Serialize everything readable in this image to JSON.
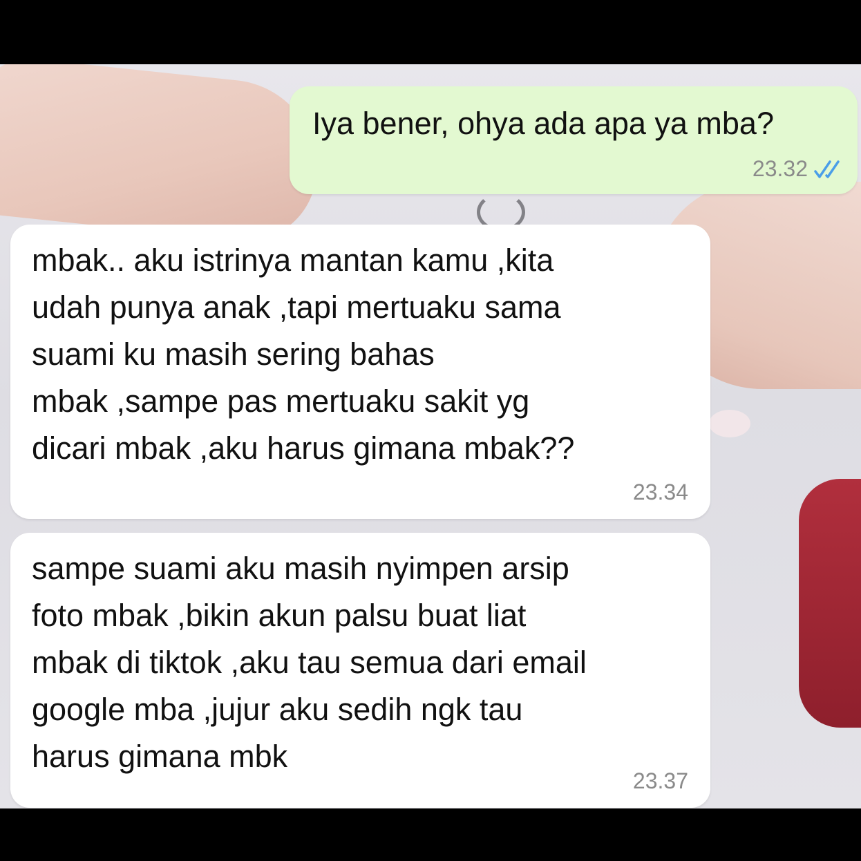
{
  "theme": {
    "outgoing_bubble_color": "#e3f9d1",
    "incoming_bubble_color": "#ffffff",
    "tick_color": "#4a9ee8"
  },
  "messages": [
    {
      "direction": "outgoing",
      "text": "Iya bener, ohya ada apa ya mba?",
      "time": "23.32",
      "status_icon": "double-check-read-icon"
    },
    {
      "direction": "incoming",
      "text": "mbak.. aku istrinya mantan kamu ,kita\nudah punya anak ,tapi mertuaku sama\nsuami ku masih sering bahas\nmbak ,sampe pas mertuaku sakit yg\ndicari mbak ,aku harus gimana mbak??",
      "time": "23.34"
    },
    {
      "direction": "incoming",
      "text": "sampe suami aku masih nyimpen arsip\nfoto mbak ,bikin akun palsu buat liat\nmbak di tiktok ,aku tau semua dari email\ngoogle mba ,jujur aku sedih ngk tau\nharus gimana mbk",
      "time": "23.37"
    }
  ]
}
